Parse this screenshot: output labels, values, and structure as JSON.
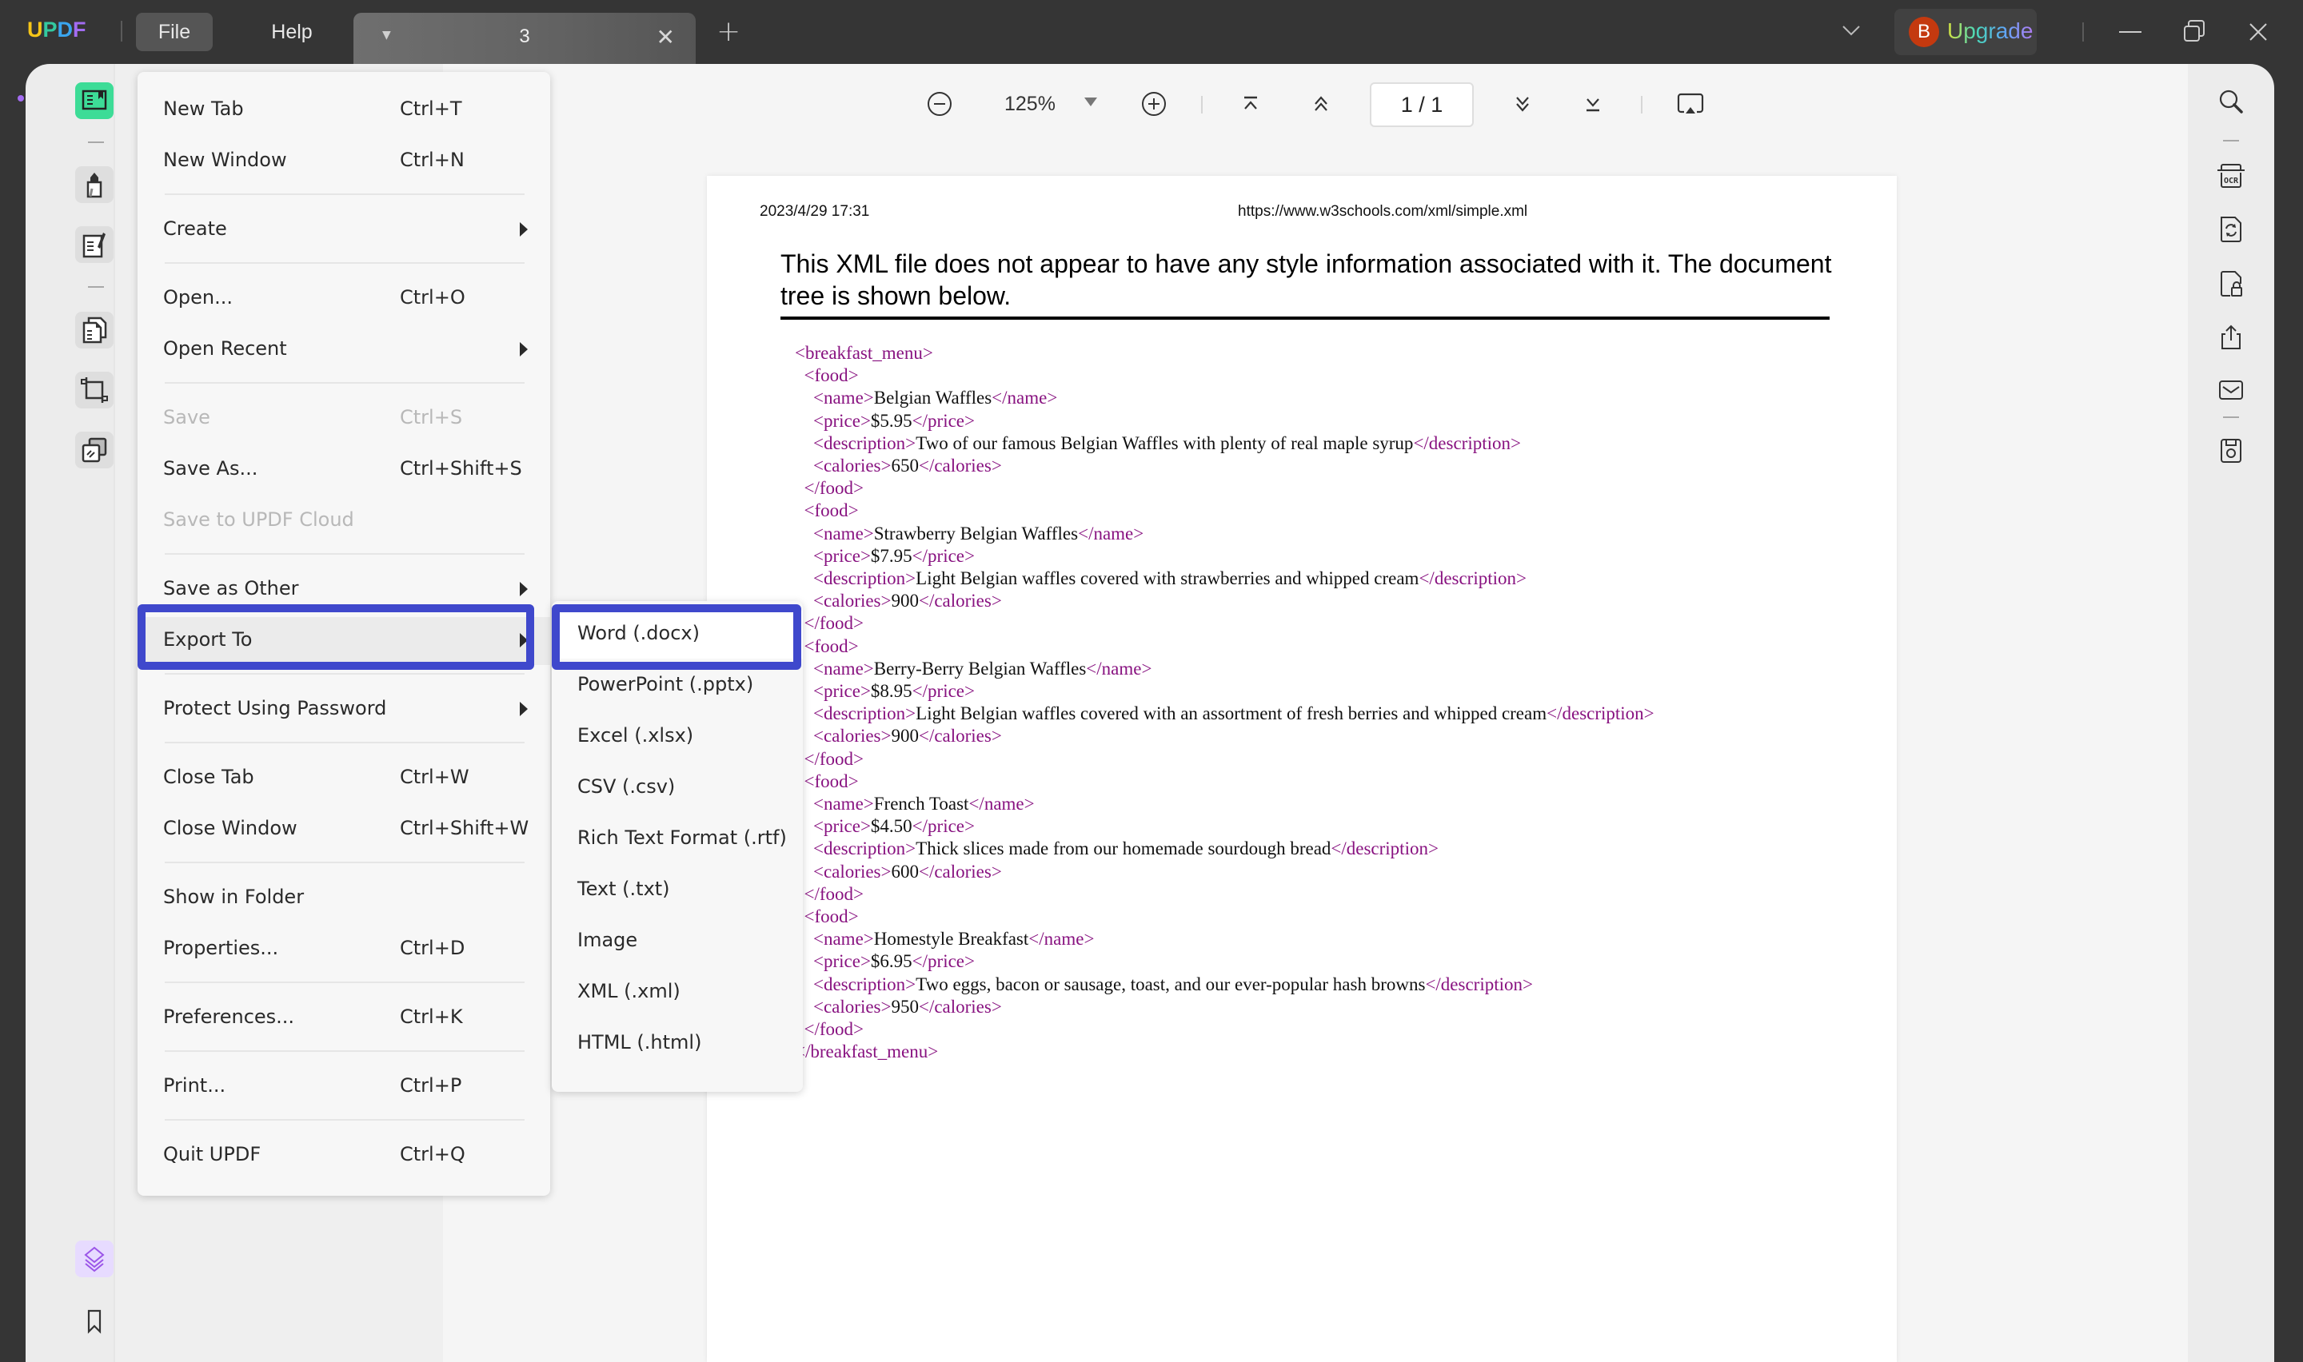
{
  "titlebar": {
    "logo_letters": [
      {
        "ch": "U",
        "color": "#f5c518"
      },
      {
        "ch": "P",
        "color": "#33c9a0"
      },
      {
        "ch": "D",
        "color": "#3aa5ee"
      },
      {
        "ch": "F",
        "color": "#a36cf2"
      }
    ],
    "menus": [
      "File",
      "Help"
    ],
    "tab_title": "3",
    "upgrade_avatar": "B",
    "upgrade_label": "Upgrade"
  },
  "toolbar": {
    "zoom_level": "125%",
    "page_indicator": "1 / 1",
    "icons": [
      "zoom-out-icon",
      "zoom-in-icon",
      "first-page-icon",
      "prev-page-icon",
      "next-page-icon",
      "last-page-icon",
      "slideshow-icon"
    ]
  },
  "left_rail": {
    "icons": [
      "reader-icon",
      "highlighter-icon",
      "edit-pdf-icon",
      "organize-pages-icon",
      "crop-icon",
      "page-tools-icon",
      "layers-icon",
      "bookmark-icon"
    ],
    "active": "reader-icon"
  },
  "right_rail": {
    "icons": [
      "search-icon",
      "ocr-icon",
      "convert-icon",
      "protect-icon",
      "share-icon",
      "email-icon",
      "save-icon"
    ]
  },
  "document": {
    "date": "2023/4/29 17:31",
    "url": "https://www.w3schools.com/xml/simple.xml",
    "heading": "This XML file does not appear to have any style information associated with it. The document tree is shown below.",
    "root_tag": "breakfast_menu",
    "foods": [
      {
        "name": "Belgian Waffles",
        "price": "$5.95",
        "description": "Two of our famous Belgian Waffles with plenty of real maple syrup",
        "calories": "650"
      },
      {
        "name": "Strawberry Belgian Waffles",
        "price": "$7.95",
        "description": "Light Belgian waffles covered with strawberries and whipped cream",
        "calories": "900"
      },
      {
        "name": "Berry-Berry Belgian Waffles",
        "price": "$8.95",
        "description": "Light Belgian waffles covered with an assortment of fresh berries and whipped cream",
        "calories": "900"
      },
      {
        "name": "French Toast",
        "price": "$4.50",
        "description": "Thick slices made from our homemade sourdough bread",
        "calories": "600"
      },
      {
        "name": "Homestyle Breakfast",
        "price": "$6.95",
        "description": "Two eggs, bacon or sausage, toast, and our ever-popular hash browns",
        "calories": "950"
      }
    ]
  },
  "file_menu": {
    "items": [
      {
        "label": "New Tab",
        "shortcut": "Ctrl+T"
      },
      {
        "label": "New Window",
        "shortcut": "Ctrl+N"
      },
      {
        "label": "Create",
        "submenu": true
      },
      {
        "label": "Open...",
        "shortcut": "Ctrl+O"
      },
      {
        "label": "Open Recent",
        "submenu": true
      },
      {
        "label": "Save",
        "shortcut": "Ctrl+S",
        "disabled": true
      },
      {
        "label": "Save As...",
        "shortcut": "Ctrl+Shift+S"
      },
      {
        "label": "Save to UPDF Cloud",
        "disabled": true
      },
      {
        "label": "Save as Other",
        "submenu": true
      },
      {
        "label": "Export To",
        "submenu": true,
        "active": true
      },
      {
        "label": "Protect Using Password",
        "submenu": true
      },
      {
        "label": "Close Tab",
        "shortcut": "Ctrl+W"
      },
      {
        "label": "Close Window",
        "shortcut": "Ctrl+Shift+W"
      },
      {
        "label": "Show in Folder"
      },
      {
        "label": "Properties...",
        "shortcut": "Ctrl+D"
      },
      {
        "label": "Preferences...",
        "shortcut": "Ctrl+K"
      },
      {
        "label": "Print...",
        "shortcut": "Ctrl+P"
      },
      {
        "label": "Quit UPDF",
        "shortcut": "Ctrl+Q"
      }
    ]
  },
  "export_submenu": {
    "items": [
      "Word (.docx)",
      "PowerPoint (.pptx)",
      "Excel (.xlsx)",
      "CSV (.csv)",
      "Rich Text Format (.rtf)",
      "Text (.txt)",
      "Image",
      "XML (.xml)",
      "HTML (.html)"
    ],
    "active": "Word (.docx)"
  },
  "highlight_color": "#3f48cc"
}
